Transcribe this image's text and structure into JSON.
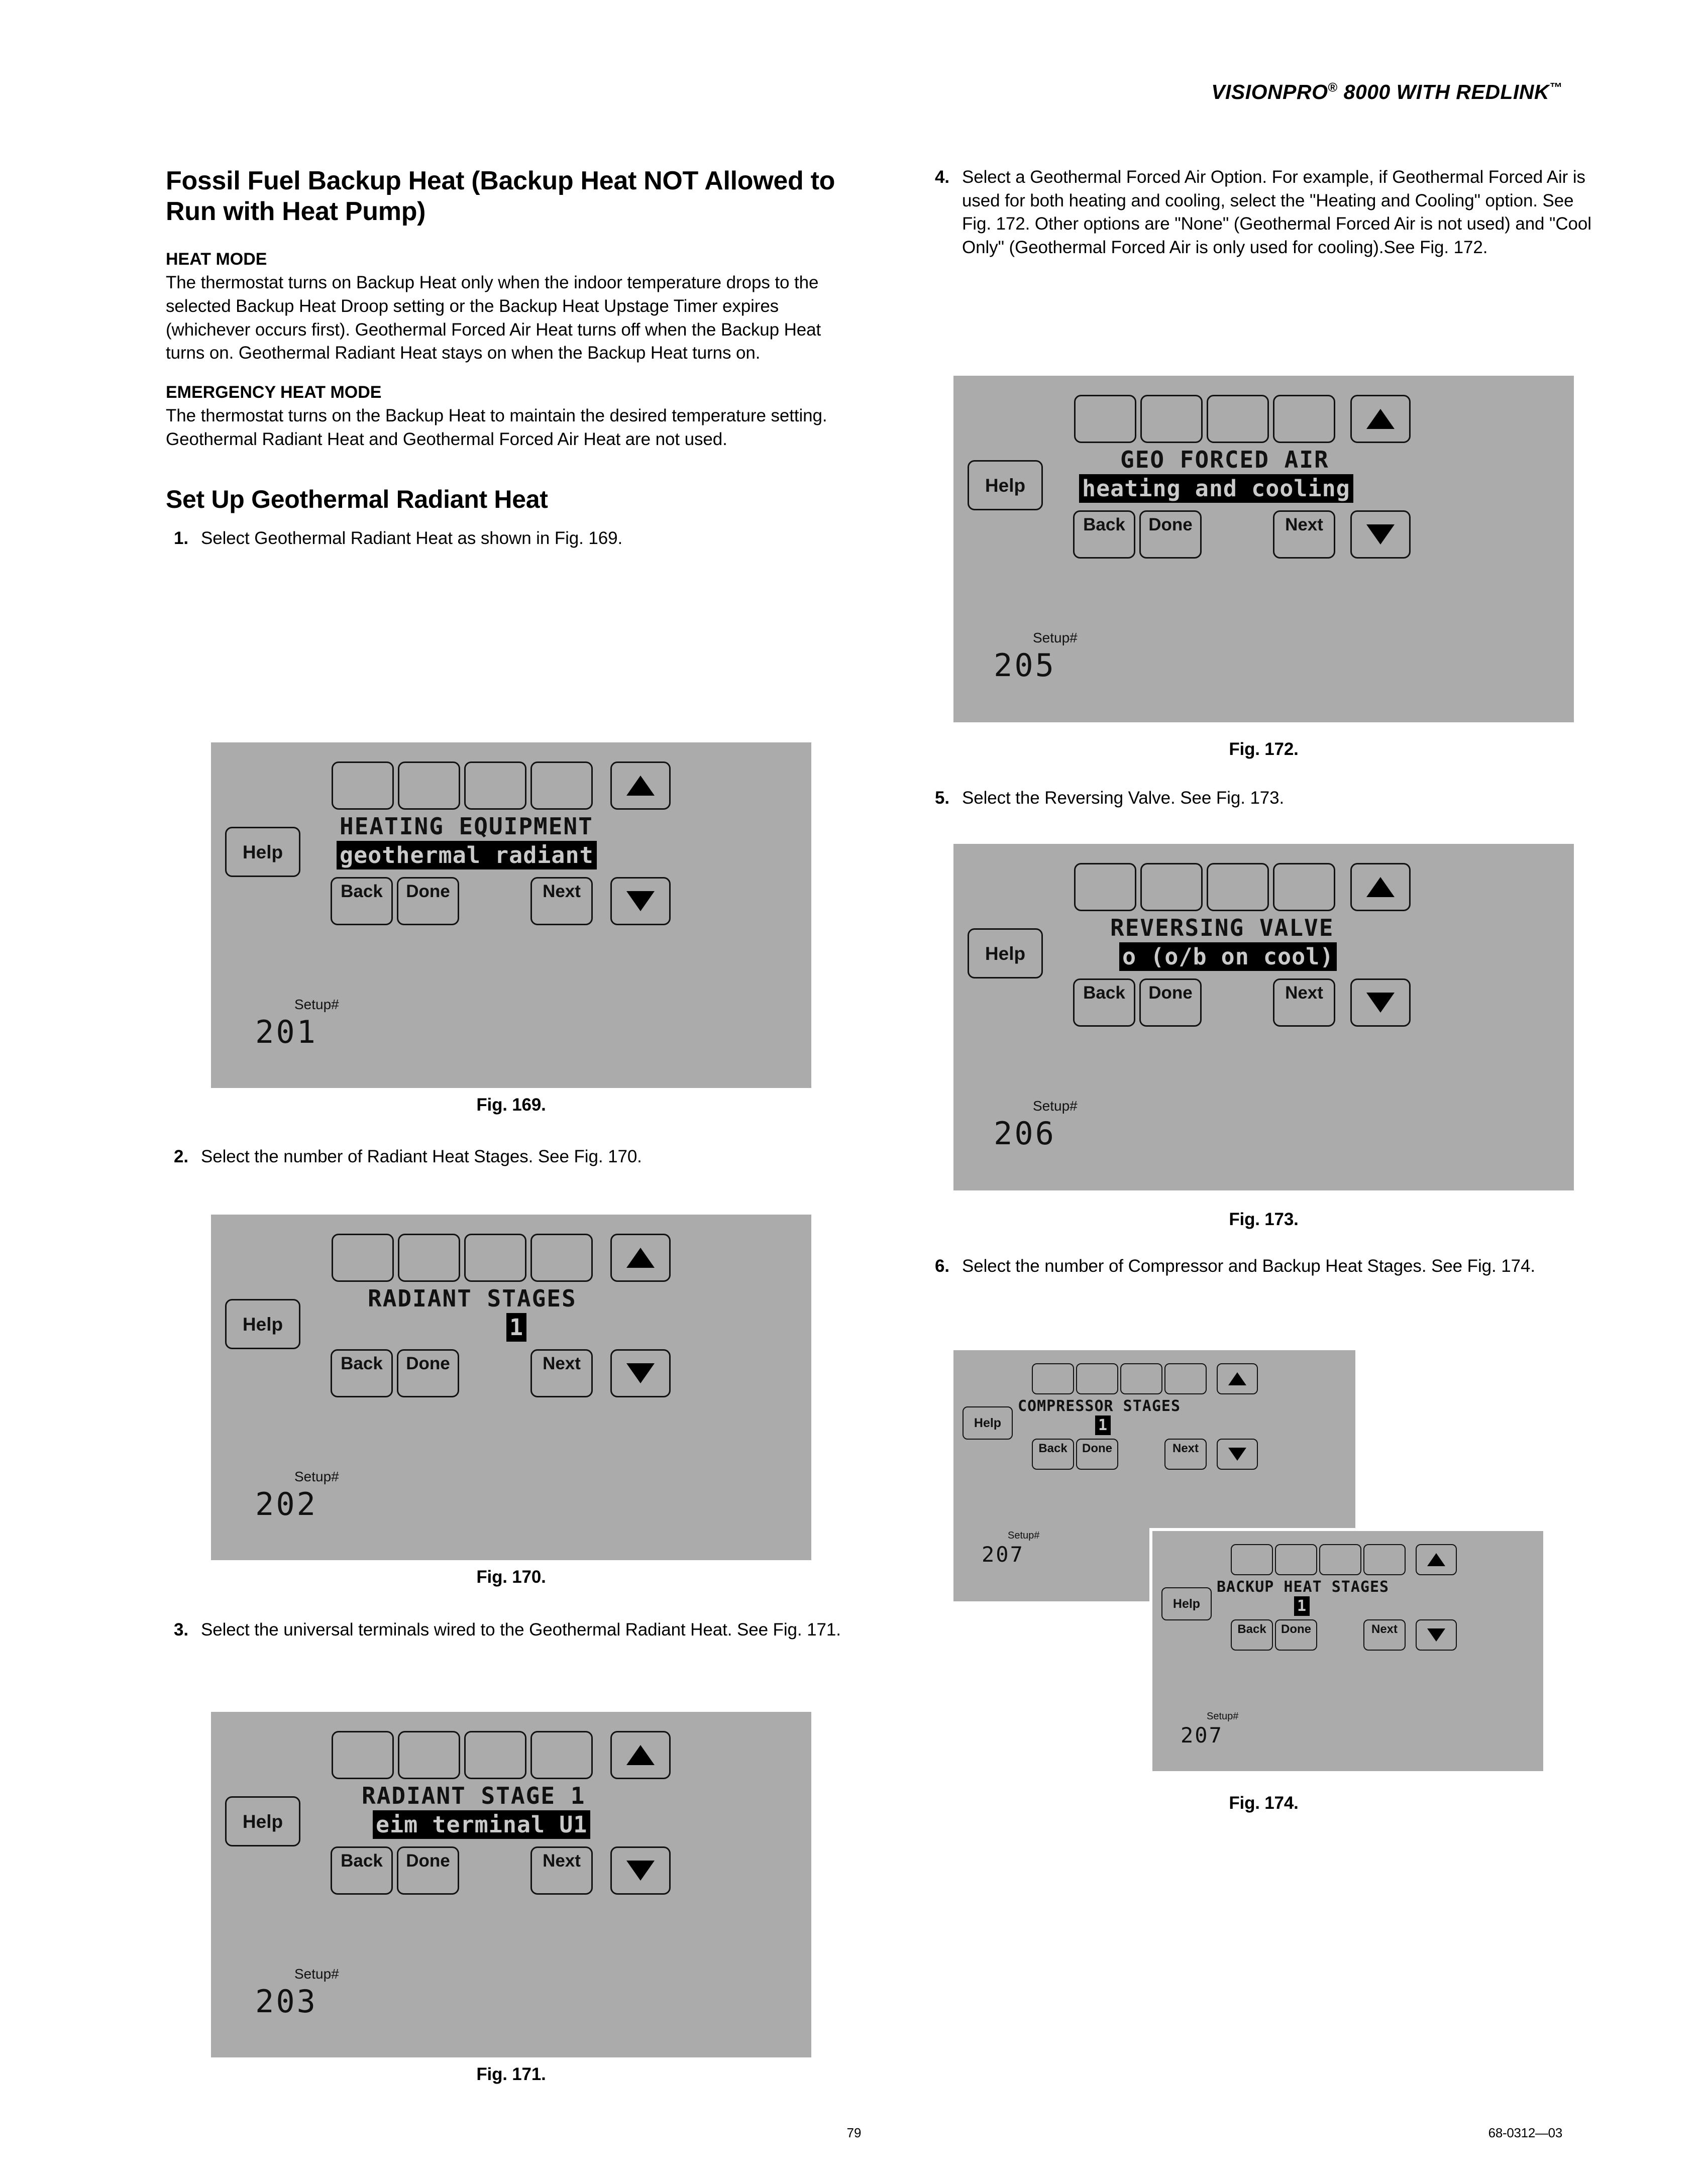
{
  "header": {
    "product": "VISIONPRO",
    "registered": "®",
    "model": " 8000 WITH REDLINK",
    "trademark": "™"
  },
  "left_column": {
    "section_title": "Fossil Fuel Backup Heat (Backup Heat NOT Allowed to Run with Heat Pump)",
    "heat_mode_head": "HEAT MODE",
    "heat_mode_body": "The thermostat turns on Backup Heat only when the indoor temperature drops to the selected Backup Heat Droop setting or the Backup Heat Upstage Timer expires (whichever occurs first). Geothermal Forced Air Heat turns off when the Backup Heat turns on. Geothermal Radiant Heat stays on when the Backup Heat turns on.",
    "emergency_head": "EMERGENCY HEAT MODE",
    "emergency_body": "The thermostat turns on the Backup Heat to maintain the desired temperature setting. Geothermal Radiant Heat and Geothermal Forced Air Heat are not used.",
    "setup_title": "Set Up Geothermal Radiant Heat",
    "steps": [
      {
        "num": "1.",
        "text": "Select Geothermal Radiant Heat as shown in Fig. 169."
      },
      {
        "num": "2.",
        "text": "Select the number of Radiant Heat Stages. See Fig. 170."
      },
      {
        "num": "3.",
        "text": "Select the universal terminals wired to the Geothermal Radiant Heat. See Fig. 171."
      }
    ],
    "captions": {
      "fig169": "Fig. 169.",
      "fig170": "Fig. 170.",
      "fig171": "Fig. 171."
    }
  },
  "right_column": {
    "steps": [
      {
        "num": "4.",
        "text": "Select a Geothermal Forced Air Option. For example, if Geothermal Forced Air is used for both heating and cooling, select the \"Heating and Cooling\" option. See Fig. 172. Other options are \"None\" (Geothermal Forced Air is not used) and \"Cool Only\" (Geothermal Forced Air is only used for cooling).See Fig. 172."
      },
      {
        "num": "5.",
        "text": "Select the Reversing Valve. See Fig. 173."
      },
      {
        "num": "6.",
        "text": "Select the number of Compressor and Backup Heat Stages. See Fig. 174."
      }
    ],
    "captions": {
      "fig172": "Fig. 172.",
      "fig173": "Fig. 173.",
      "fig174": "Fig. 174."
    }
  },
  "thermostat_buttons": {
    "help": "Help",
    "back": "Back",
    "done": "Done",
    "next": "Next",
    "up_arrow": "▲",
    "down_arrow": "▼"
  },
  "screens": {
    "fig169": {
      "title": "HEATING EQUIPMENT",
      "value": "geothermal radiant",
      "setup_label": "Setup#",
      "setup_number": "201"
    },
    "fig170": {
      "title": "RADIANT STAGES",
      "value": "1",
      "setup_label": "Setup#",
      "setup_number": "202"
    },
    "fig171": {
      "title": "RADIANT STAGE 1",
      "value": "eim terminal U1",
      "setup_label": "Setup#",
      "setup_number": "203"
    },
    "fig172": {
      "title": "GEO FORCED AIR",
      "value": "heating and cooling",
      "setup_label": "Setup#",
      "setup_number": "205"
    },
    "fig173": {
      "title": "REVERSING VALVE",
      "value": "o (o/b on cool)",
      "setup_label": "Setup#",
      "setup_number": "206"
    },
    "fig174_back": {
      "title": "COMPRESSOR STAGES",
      "value": "1",
      "setup_label": "Setup#",
      "setup_number": "207"
    },
    "fig174_front": {
      "title": "BACKUP HEAT STAGES",
      "value": "1",
      "setup_label": "Setup#",
      "setup_number": "207"
    }
  },
  "footer": {
    "page_number": "79",
    "document_code": "68-0312—03"
  },
  "colors": {
    "lcd_background": "#ababab",
    "lcd_ink": "#111111",
    "highlight_background": "#000000",
    "highlight_text": "#c9c9c9",
    "page_background": "#ffffff"
  }
}
